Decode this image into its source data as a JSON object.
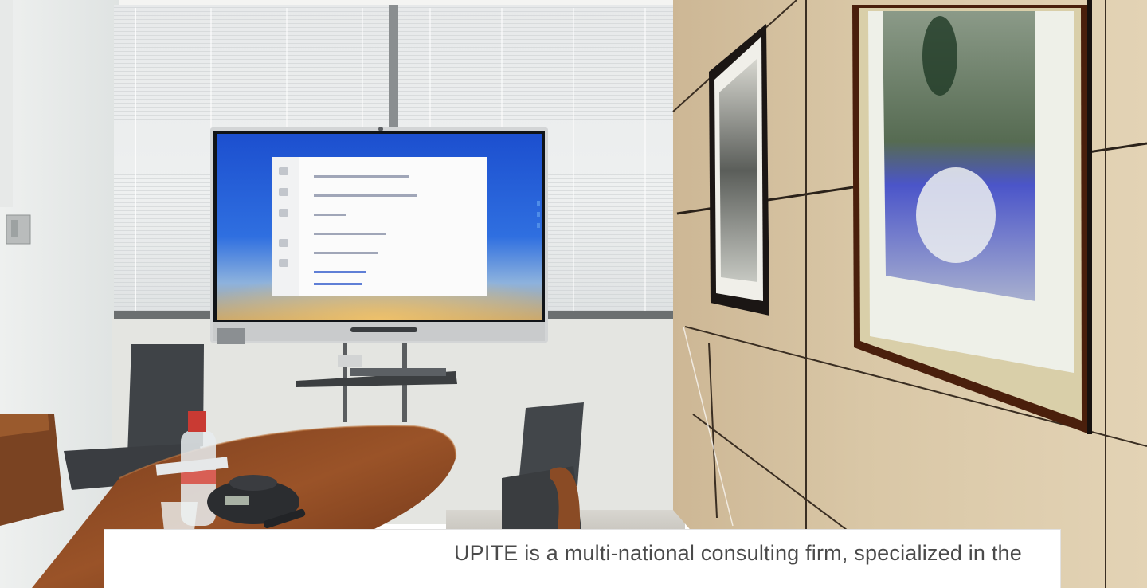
{
  "caption": {
    "text": "UPITE is a multi-national consulting firm, specialized in the"
  },
  "photo": {
    "screen_file_list": [
      "",
      "",
      "",
      "",
      "",
      "",
      ""
    ]
  },
  "colors": {
    "caption_text": "#4a4a4a",
    "wall_panels": "#d9c7a6",
    "screen_blue": "#1f5ad8",
    "frame_wood": "#4a1f0c"
  }
}
